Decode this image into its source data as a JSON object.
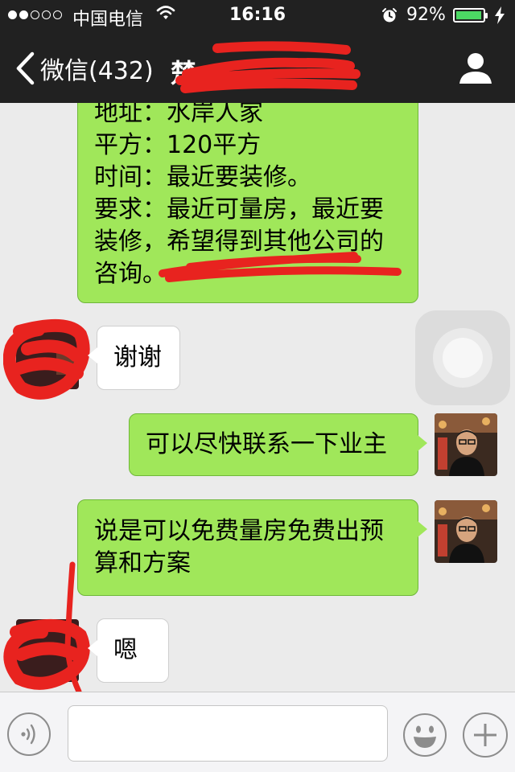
{
  "status_bar": {
    "carrier": "中国电信",
    "time": "16:16",
    "battery_percent": "92%",
    "battery_level": 0.92,
    "signal_bars_filled": 2,
    "signal_bars_total": 5
  },
  "nav": {
    "back_label": "微信(432)",
    "title": "楚"
  },
  "messages": [
    {
      "direction": "out",
      "lines": [
        "地址：水岸人家",
        "平方：120平方",
        "时间：最近要装修。",
        "要求：最近可量房，最近要",
        "装修，希望得到其他公司的",
        "咨询。"
      ]
    },
    {
      "direction": "in",
      "text": "谢谢"
    },
    {
      "direction": "out",
      "text": "可以尽快联系一下业主"
    },
    {
      "direction": "out",
      "lines": [
        "说是可以免费量房免费出预",
        "算和方案"
      ]
    },
    {
      "direction": "in",
      "text": "嗯"
    }
  ],
  "input_bar": {
    "placeholder": ""
  },
  "colors": {
    "nav_background": "#212121",
    "chat_background": "#ebebeb",
    "outgoing_bubble": "#a0e75a",
    "incoming_bubble": "#ffffff",
    "redaction": "#e8231f",
    "battery_fill": "#4cd964"
  },
  "icons": {
    "back": "chevron-left-icon",
    "profile": "person-icon",
    "wifi": "wifi-icon",
    "alarm": "alarm-clock-icon",
    "charging": "lightning-bolt-icon",
    "voice": "voice-wave-icon",
    "emoji": "smiley-face-icon",
    "more": "plus-icon"
  }
}
